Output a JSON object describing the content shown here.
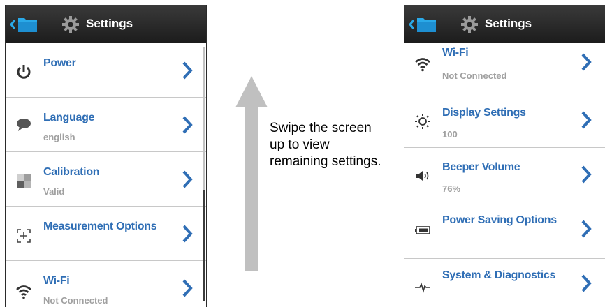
{
  "header": {
    "title": "Settings"
  },
  "left_screen": {
    "items": [
      {
        "label": "Power",
        "value": "",
        "icon": "power-icon"
      },
      {
        "label": "Language",
        "value": "english",
        "icon": "speech-bubble-icon"
      },
      {
        "label": "Calibration",
        "value": "Valid",
        "icon": "calibration-icon"
      },
      {
        "label": "Measurement Options",
        "value": "",
        "icon": "crosshair-icon"
      },
      {
        "label": "Wi-Fi",
        "value": "Not Connected",
        "icon": "wifi-icon"
      }
    ]
  },
  "right_screen": {
    "items": [
      {
        "label": "Wi-Fi",
        "value": "Not Connected",
        "icon": "wifi-icon"
      },
      {
        "label": "Display Settings",
        "value": "100",
        "icon": "brightness-icon"
      },
      {
        "label": "Beeper Volume",
        "value": "76%",
        "icon": "speaker-icon"
      },
      {
        "label": "Power Saving Options",
        "value": "",
        "icon": "battery-icon"
      },
      {
        "label": "System & Diagnostics",
        "value": "",
        "icon": "pulse-icon"
      }
    ]
  },
  "instruction": "Swipe the screen up to view remaining settings.",
  "colors": {
    "accent": "#2f6eb5",
    "header_bg": "#262626",
    "subtext": "#a0a0a0"
  }
}
